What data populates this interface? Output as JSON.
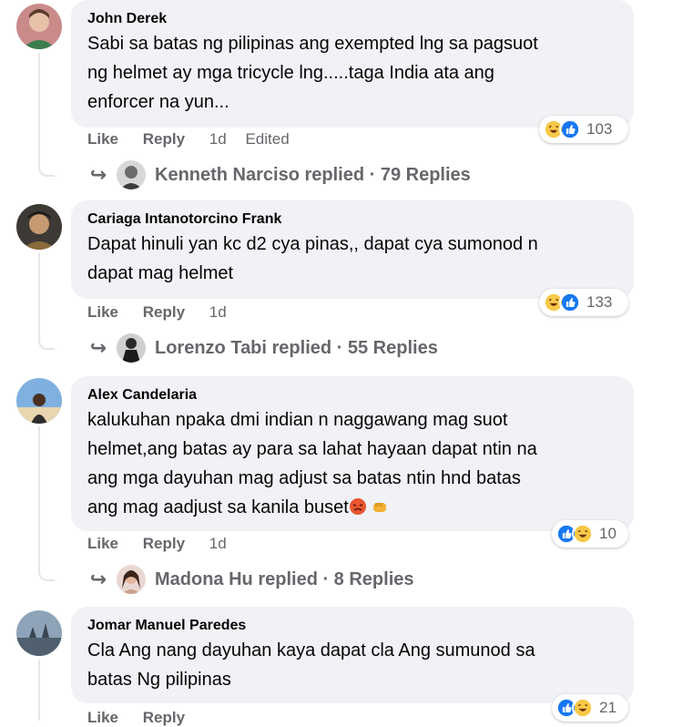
{
  "comments": [
    {
      "author": "John Derek",
      "lines": [
        "Sabi sa batas ng pilipinas ang exempted lng sa pagsuot",
        "ng helmet ay mga tricycle lng.....taga India ata ang",
        "enforcer na yun..."
      ],
      "like": "Like",
      "reply": "Reply",
      "time": "1d",
      "edited": "Edited",
      "reaction_count": "103",
      "reply_summary": "Kenneth Narciso replied · 79 Replies"
    },
    {
      "author": "Cariaga Intanotorcino Frank",
      "lines": [
        "Dapat hinuli yan kc d2 cya pinas,, dapat cya sumonod n",
        "dapat mag helmet"
      ],
      "like": "Like",
      "reply": "Reply",
      "time": "1d",
      "reaction_count": "133",
      "reply_summary": "Lorenzo Tabi replied · 55 Replies"
    },
    {
      "author": "Alex Candelaria",
      "lines": [
        "kalukuhan npaka dmi indian n naggawang mag suot",
        "helmet,ang batas ay para sa lahat hayaan dapat ntin na",
        "ang mga dayuhan mag adjust sa batas ntin hnd batas",
        "ang mag aadjust sa kanila buset"
      ],
      "like": "Like",
      "reply": "Reply",
      "time": "1d",
      "reaction_count": "10",
      "reply_summary": "Madona Hu replied · 8 Replies"
    },
    {
      "author": "Jomar Manuel Paredes",
      "lines": [
        "Cla Ang nang dayuhan kaya dapat cla Ang sumunod sa",
        "batas Ng pilipinas"
      ],
      "like": "Like",
      "reply": "Reply",
      "reaction_count": "21"
    }
  ],
  "colors": {
    "bubble": "#f0f2f5",
    "meta_text": "#65676b",
    "like_blue": "#1877f2",
    "haha_yellow": "#f7c948"
  },
  "icons": [
    "haha-reaction-icon",
    "like-reaction-icon",
    "reply-arrow-icon",
    "angry-emoji-icon",
    "fist-emoji-icon"
  ]
}
